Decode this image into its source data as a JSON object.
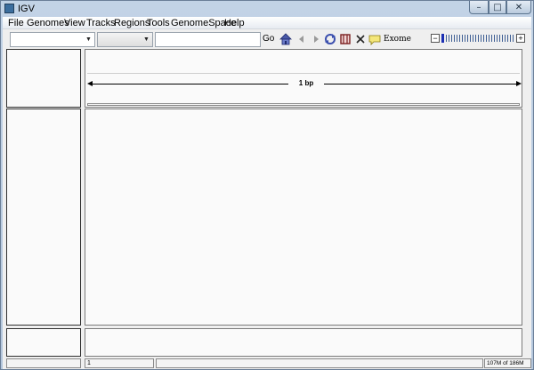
{
  "window": {
    "title": "IGV",
    "minimize_glyph": "–",
    "maximize_glyph": "□",
    "close_glyph": "✕"
  },
  "menubar": {
    "items": [
      "File",
      "Genomes",
      "View",
      "Tracks",
      "Regions",
      "Tools",
      "GenomeSpace",
      "Help"
    ]
  },
  "toolbar": {
    "genome_value": "",
    "chromosome_value": "",
    "locus_value": "",
    "go_label": "Go",
    "exome_label": "Exome",
    "icons": [
      "home-icon",
      "back-arrow-icon",
      "forward-arrow-icon",
      "refresh-icon",
      "region-of-interest-icon",
      "close-icon",
      "popup-text-icon"
    ],
    "zoom_minus_label": "−",
    "zoom_plus_label": "+",
    "zoom_level": 0
  },
  "ruler": {
    "scale_label": "1 bp"
  },
  "statusbar": {
    "position": "1",
    "message": "",
    "memory": "107M of 186M"
  },
  "colors": {
    "title_bar": "#b9cbe0",
    "close_button": "#c75a46",
    "zoom_thumb": "#1c2fb3",
    "zoom_ticks": "#3e5e93"
  }
}
